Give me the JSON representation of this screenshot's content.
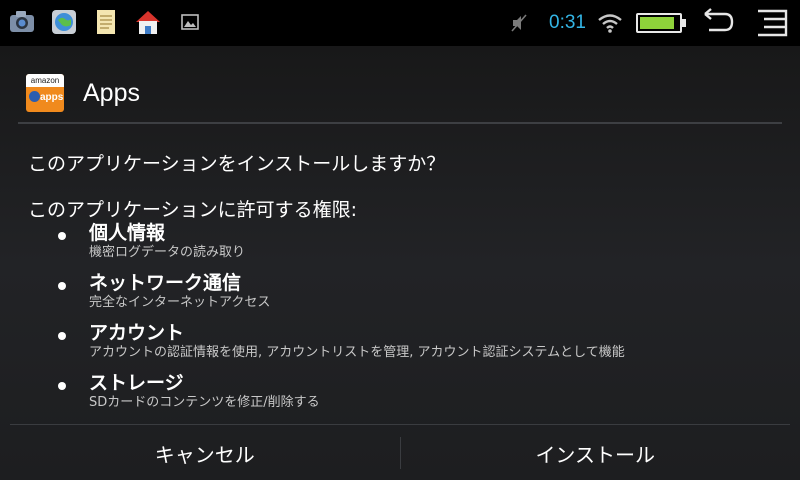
{
  "status_bar": {
    "notification_icons": [
      "camera-icon",
      "globe-icon",
      "notes-icon",
      "house-icon",
      "image-icon"
    ],
    "clock": "0:31",
    "battery_level": 0.9,
    "accent_color": "#33b5e5",
    "battery_color": "#8ed23a"
  },
  "dialog": {
    "app_icon": {
      "top_text": "amazon",
      "bottom_text": "apps"
    },
    "title": "Apps",
    "question": "このアプリケーションをインストールしますか？",
    "permissions_header": "このアプリケーションに許可する権限:",
    "permissions": [
      {
        "title": "個人情報",
        "description": "機密ログデータの読み取り"
      },
      {
        "title": "ネットワーク通信",
        "description": "完全なインターネットアクセス"
      },
      {
        "title": "アカウント",
        "description": "アカウントの認証情報を使用, アカウントリストを管理, アカウント認証システムとして機能"
      },
      {
        "title": "ストレージ",
        "description": "SDカードのコンテンツを修正/削除する"
      }
    ],
    "buttons": {
      "cancel": "キャンセル",
      "install": "インストール"
    }
  }
}
